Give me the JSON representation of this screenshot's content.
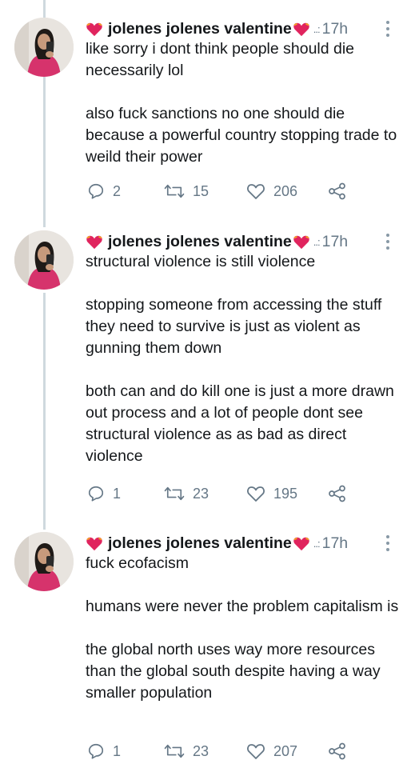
{
  "colors": {
    "text": "#14171a",
    "muted": "#657786",
    "line": "#cfd9de",
    "heart": "#e0245e"
  },
  "icons": {
    "reply": "reply-icon",
    "retweet": "retweet-icon",
    "like": "like-icon",
    "share": "share-icon",
    "more": "more-icon",
    "heart": "heart-emoji-icon"
  },
  "tweets": [
    {
      "name": "jolenes jolenes valentine",
      "dots": "..:",
      "time": "17h",
      "paragraphs": [
        "like sorry i dont think people should die necessarily lol",
        "also fuck sanctions no one should die because a powerful country stopping trade to weild their power"
      ],
      "replies": "2",
      "retweets": "15",
      "likes": "206"
    },
    {
      "name": "jolenes jolenes valentine",
      "dots": "..:",
      "time": "17h",
      "paragraphs": [
        "structural violence is still violence",
        "stopping someone from accessing the stuff they need to survive is just as violent as gunning them down",
        "both can and do kill one is just a more drawn out process and a lot of people dont see structural violence as as bad as direct violence"
      ],
      "replies": "1",
      "retweets": "23",
      "likes": "195"
    },
    {
      "name": "jolenes jolenes valentine",
      "dots": "..:",
      "time": "17h",
      "paragraphs": [
        "fuck ecofacism",
        "humans were never the problem capitalism is",
        "the global north uses way more resources than the global south despite having a way smaller population"
      ],
      "replies": "1",
      "retweets": "23",
      "likes": "207"
    }
  ]
}
